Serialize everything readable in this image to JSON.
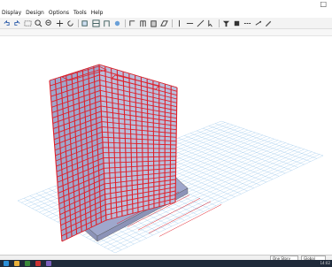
{
  "window": {
    "controls": "□"
  },
  "menu": {
    "items": [
      "Display",
      "Design",
      "Options",
      "Tools",
      "Help"
    ]
  },
  "toolbar": {
    "icons": [
      "undo-icon",
      "redo-icon",
      "rubber-band-zoom-icon",
      "zoom-in-icon",
      "zoom-out-icon",
      "pan-icon",
      "refresh-icon",
      "3d-view-icon",
      "plan-view-icon",
      "elevation-view-icon",
      "rotate-icon",
      "set-display-icon",
      "frame-icon",
      "wall-icon",
      "area-icon",
      "column-icon",
      "beam-icon",
      "brace-icon",
      "select-icon",
      "filter-icon",
      "section-icon",
      "line-icon",
      "snap-icon",
      "draw-icon"
    ]
  },
  "statusbar": {
    "story": "One Story",
    "coord": "Global"
  },
  "taskbar": {
    "clock": "14:02"
  },
  "colors": {
    "frame": "#e0202a",
    "slab": "#9fa7cc",
    "grid": "#7fb7e6"
  }
}
